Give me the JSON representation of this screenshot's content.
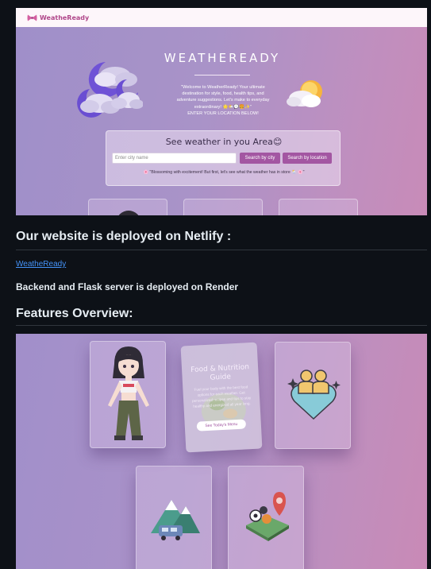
{
  "screenshot1": {
    "nav": {
      "logo_text": "WeatheReady",
      "logo_icon": "bow-icon"
    },
    "hero": {
      "title": "WEATHEREADY",
      "intro_lines": [
        "\"Welcome to WeatherReady! Your ultimate",
        "destination for style, food, health tips, and",
        "adventure suggestions. Let's make to everyday",
        "extraordinary! 🌟🌤️💬🍔✨\"",
        "ENTER YOUR LOCATION BELOW!"
      ]
    },
    "search_card": {
      "title": "See weather in you Area😊",
      "city_placeholder": "Enter city name",
      "search_city_label": "Search by city",
      "search_location_label": "Search by location",
      "message": "🌸 \"Blossoming with excitement! But first, let's see what the weather has in store 🌦️ 🌸\""
    }
  },
  "readme": {
    "netlify_heading": "Our website is deployed on Netlify :",
    "netlify_link": "WeatheReady",
    "render_text": "Backend and Flask server is deployed on Render",
    "features_heading": "Features Overview:"
  },
  "screenshot2": {
    "nutrition_card": {
      "title": "Food & Nutrition Guide",
      "text": "Fuel your body with the best food options for each weather. Get personalized recipes and tips to stay healthy and energized all year long.",
      "button_label": "See Today's Menu"
    },
    "cards": [
      "avatar-illustration",
      "nutrition-guide",
      "health-hearts-icon",
      "travel-mountains-icon",
      "sports-map-icon"
    ]
  },
  "colors": {
    "page_bg": "#0d1117",
    "heading": "#e6edf3",
    "link": "#4493f8",
    "accent_button": "#a356a2",
    "logo": "#b0478a"
  }
}
